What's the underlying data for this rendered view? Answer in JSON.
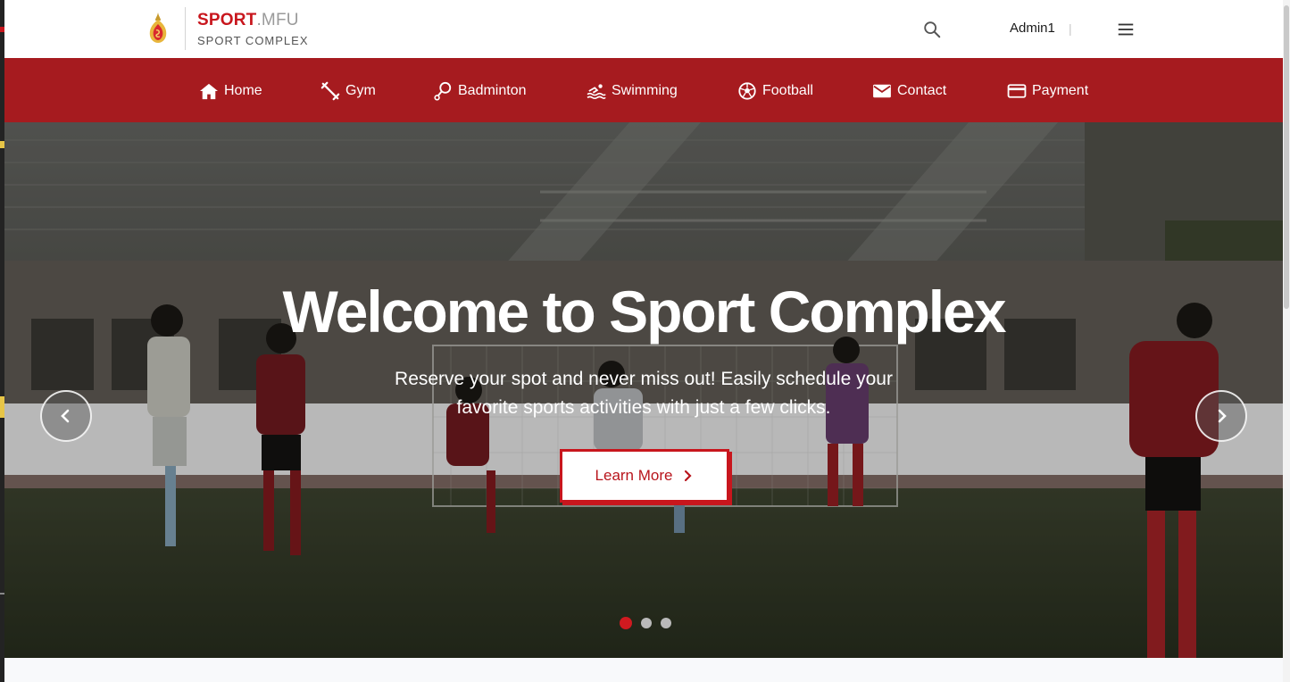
{
  "header": {
    "brand_primary": "SPORT",
    "brand_secondary": ".MFU",
    "brand_sub": "SPORT COMPLEX",
    "user_name": "Admin1",
    "user_separator": "|"
  },
  "nav": {
    "items": [
      {
        "label": "Home",
        "icon": "home-icon"
      },
      {
        "label": "Gym",
        "icon": "dumbbell-icon"
      },
      {
        "label": "Badminton",
        "icon": "badminton-icon"
      },
      {
        "label": "Swimming",
        "icon": "swimming-icon"
      },
      {
        "label": "Football",
        "icon": "football-icon"
      },
      {
        "label": "Contact",
        "icon": "mail-icon"
      },
      {
        "label": "Payment",
        "icon": "credit-card-icon"
      }
    ]
  },
  "hero": {
    "title": "Welcome to Sport Complex",
    "text_line1": "Reserve your spot and never miss out! Easily schedule your",
    "text_line2": "favorite sports activities with just a few clicks.",
    "cta_label": "Learn More",
    "slides": 3,
    "active_slide": 1
  },
  "colors": {
    "brand_red": "#a61b1f",
    "accent_red": "#c8161d",
    "text_dark": "#1a1a1a"
  }
}
